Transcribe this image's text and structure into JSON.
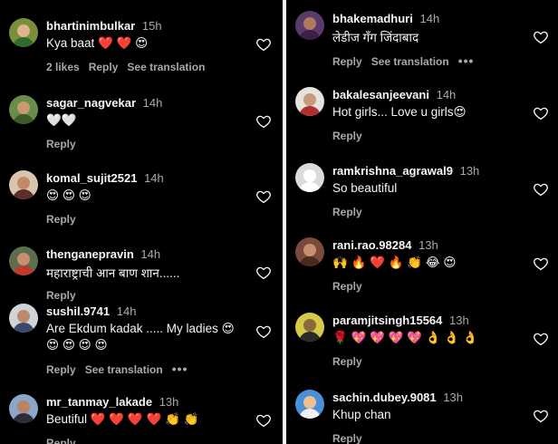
{
  "left_comments": [
    {
      "username": "bhartinimbulkar",
      "time": "15h",
      "text": "Kya baat ❤️ ❤️ 😍",
      "likes": "2 likes",
      "reply": "Reply",
      "see_translation": "See translation",
      "avatar_bg": "#7a8f3a",
      "face": "#e0b48c",
      "body": "#2f6d2a"
    },
    {
      "username": "sagar_nagvekar",
      "time": "14h",
      "text": "🤍🤍",
      "reply": "Reply",
      "avatar_bg": "#6a8c4a",
      "face": "#c99a6e",
      "body": "#3a5a2a"
    },
    {
      "username": "komal_sujit2521",
      "time": "14h",
      "text": "😍 😍 😍",
      "reply": "Reply",
      "avatar_bg": "#d9c4b0",
      "face": "#c28a66",
      "body": "#5a2f2a"
    },
    {
      "username": "thenganepravin",
      "time": "14h",
      "text": "महाराष्ट्राची आन बाण शान......",
      "reply": "Reply",
      "avatar_bg": "#5d6e4c",
      "face": "#c89070",
      "body": "#c0392b"
    },
    {
      "username": "sushil.9741",
      "time": "14h",
      "text": "Are Ekdum kadak ..... My ladies 😍",
      "text2": "😍 😍 😍 😍",
      "reply": "Reply",
      "see_translation": "See translation",
      "more": "•••",
      "avatar_bg": "#cfd4da",
      "face": "#c08a6a",
      "body": "#3b4a6b"
    },
    {
      "username": "mr_tanmay_lakade",
      "time": "13h",
      "text": "Beutiful ❤️ ❤️ ❤️ ❤️ 👏 👏",
      "reply": "Reply",
      "avatar_bg": "#8aa6c8",
      "face": "#b98464",
      "body": "#2d2d3a"
    }
  ],
  "right_comments": [
    {
      "username": "bhakemadhuri",
      "time": "14h",
      "text": "लेडीज गँग जिंदाबाद",
      "reply": "Reply",
      "see_translation": "See translation",
      "more": "•••",
      "avatar_bg": "#5a3a6a",
      "face": "#b07a60",
      "body": "#3a1f4a"
    },
    {
      "username": "bakalesanjeevani",
      "time": "14h",
      "text": "Hot girls... Love u girls😍",
      "reply": "Reply",
      "avatar_bg": "#e7e2dc",
      "face": "#c79a7c",
      "body": "#b03030"
    },
    {
      "username": "ramkrishna_agrawal9",
      "time": "13h",
      "text": "So beautiful",
      "reply": "Reply",
      "avatar_bg": "#dbdbdb",
      "face": "#ffffff",
      "body": "#ffffff"
    },
    {
      "username": "rani.rao.98284",
      "time": "13h",
      "text": "🙌 🔥 ❤️ 🔥 👏 😂 😍",
      "reply": "Reply",
      "avatar_bg": "#7a4a3a",
      "face": "#c79070",
      "body": "#4a2a20"
    },
    {
      "username": "paramjitsingh15564",
      "time": "13h",
      "text": "🌹 💖 💖 💖 💖 👌 👌 👌",
      "reply": "Reply",
      "avatar_bg": "#d8c84a",
      "face": "#8a6a3a",
      "body": "#2a2a2a"
    },
    {
      "username": "sachin.dubey.9081",
      "time": "13h",
      "text": "Khup chan",
      "reply": "Reply",
      "avatar_bg": "#4a90d9",
      "face": "#f0c090",
      "body": "#f0f0f0"
    }
  ],
  "colors": {
    "background": "#000000",
    "text": "#f5f5f5",
    "muted": "#a8a8a8",
    "divider": "#ffffff"
  },
  "icons": {
    "like": "heart-outline-icon"
  }
}
